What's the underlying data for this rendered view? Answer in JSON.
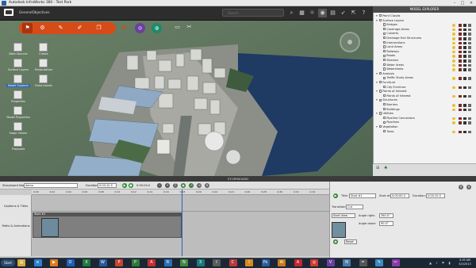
{
  "window": {
    "title": "Autodesk InfraWorks 360 - Test Park"
  },
  "topbar": {
    "model_name": "GeneralObjectives",
    "search_placeholder": "Search"
  },
  "toolbar": {
    "tools": [
      "pin-icon",
      "settings-icon",
      "brush-icon",
      "pencil-icon",
      "copy-icon",
      "path-icon",
      "glasses-icon",
      "globe-icon"
    ]
  },
  "palette": {
    "items": [
      "Data Sources",
      "Create",
      "Surface Layers",
      "Presentation",
      "Model Explorer",
      "Draw Assets",
      "Properties",
      "Model Properties",
      "Slope Viewer",
      "Proposals"
    ]
  },
  "explorer": {
    "title": "MODEL EXPLORER",
    "rows": [
      {
        "label": "Point Clouds",
        "indent": 0
      },
      {
        "label": "Surface Layers",
        "indent": 0
      },
      {
        "label": "Bridges",
        "indent": 2
      },
      {
        "label": "Coverage Areas",
        "indent": 2
      },
      {
        "label": "Culverts",
        "indent": 2
      },
      {
        "label": "Drainage End Structures",
        "indent": 2
      },
      {
        "label": "Intersections",
        "indent": 2
      },
      {
        "label": "Land Areas",
        "indent": 2
      },
      {
        "label": "Railways",
        "indent": 2
      },
      {
        "label": "Roads",
        "indent": 2
      },
      {
        "label": "Streams",
        "indent": 2
      },
      {
        "label": "Water Areas",
        "indent": 2
      },
      {
        "label": "Watersheds",
        "indent": 2
      },
      {
        "label": "Analysis",
        "indent": 0
      },
      {
        "label": "Traffic Study Areas",
        "indent": 2
      },
      {
        "label": "Furniture",
        "indent": 0
      },
      {
        "label": "City Furniture",
        "indent": 2
      },
      {
        "label": "Points of Interest",
        "indent": 0
      },
      {
        "label": "Points of Interest",
        "indent": 2
      },
      {
        "label": "Structures",
        "indent": 0
      },
      {
        "label": "Barriers",
        "indent": 2
      },
      {
        "label": "Buildings",
        "indent": 2
      },
      {
        "label": "Utilities",
        "indent": 0
      },
      {
        "label": "Pipeline Connectors",
        "indent": 2
      },
      {
        "label": "Pipelines",
        "indent": 2
      },
      {
        "label": "Vegetation",
        "indent": 0
      },
      {
        "label": "Trees",
        "indent": 2
      }
    ]
  },
  "storyboard": {
    "title": "STORYBOARD",
    "name_label": "Storyboard Name:",
    "name_value": "demo",
    "duration_label": "Duration:",
    "duration_value": "0:00:10.5",
    "time_readout": "0:00:00.0",
    "ticks": [
      "0:00",
      "0:02",
      "0:04",
      "0:06",
      "0:08",
      "0:10",
      "0:12",
      "0:14",
      "0:16",
      "0:18",
      "0:20",
      "0:22",
      "0:24",
      "0:26",
      "0:28",
      "0:30",
      "0:32",
      "0:34"
    ],
    "tracks": [
      "Captions & Titles",
      "Paths & Animations"
    ],
    "clip_label": "Start #1"
  },
  "props": {
    "title_label": "Title:",
    "title_value": "Start #1",
    "start_label": "Start at:",
    "start_value": "0:00:00.0",
    "duration_label": "Duration:",
    "duration_value": "0:00:10.5",
    "transition_label": "Transition:",
    "transition_value": "Cut",
    "view_label": "Start View",
    "angle_right_label": "Angle right:",
    "angle_right_value": "360.0°",
    "angle_down_label": "Angle down:",
    "angle_down_value": "90.0°",
    "reset_label": "Reset"
  },
  "taskbar": {
    "start_label": "Start",
    "time": "4:39 AM",
    "date": "5/2/2013"
  }
}
